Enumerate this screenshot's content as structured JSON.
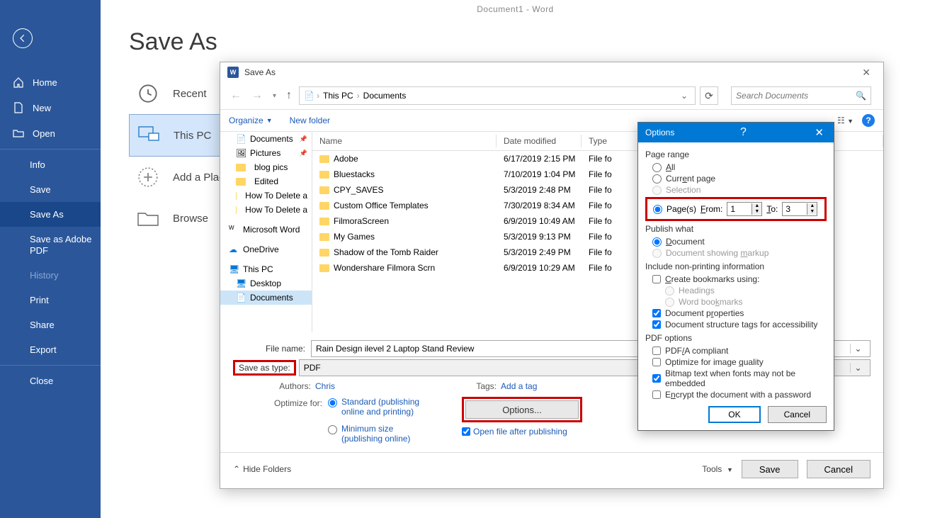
{
  "titlebar": "Document1  -  Word",
  "page_heading": "Save As",
  "sidebar": {
    "home": "Home",
    "new": "New",
    "open": "Open",
    "info": "Info",
    "save": "Save",
    "save_as": "Save As",
    "save_adobe": "Save as Adobe PDF",
    "history": "History",
    "print": "Print",
    "share": "Share",
    "export": "Export",
    "close": "Close"
  },
  "locations": {
    "recent": "Recent",
    "this_pc": "This PC",
    "add_place": "Add a Place",
    "browse": "Browse"
  },
  "dialog": {
    "title": "Save As",
    "breadcrumb": {
      "seg1": "This PC",
      "seg2": "Documents"
    },
    "search_placeholder": "Search Documents",
    "organize": "Organize",
    "new_folder": "New folder",
    "cols": {
      "name": "Name",
      "date": "Date modified",
      "type": "Type"
    },
    "tree": {
      "documents": "Documents",
      "pictures": "Pictures",
      "blog": "blog pics",
      "edited": "Edited",
      "howto1": "How To Delete a",
      "howto2": "How To Delete a",
      "msword": "Microsoft Word",
      "onedrive": "OneDrive",
      "thispc": "This PC",
      "desktop": "Desktop",
      "documents2": "Documents"
    },
    "files": [
      {
        "name": "Adobe",
        "date": "6/17/2019 2:15 PM",
        "type": "File fo"
      },
      {
        "name": "Bluestacks",
        "date": "7/10/2019 1:04 PM",
        "type": "File fo"
      },
      {
        "name": "CPY_SAVES",
        "date": "5/3/2019 2:48 PM",
        "type": "File fo"
      },
      {
        "name": "Custom Office Templates",
        "date": "7/30/2019 8:34 AM",
        "type": "File fo"
      },
      {
        "name": "FilmoraScreen",
        "date": "6/9/2019 10:49 AM",
        "type": "File fo"
      },
      {
        "name": "My Games",
        "date": "5/3/2019 9:13 PM",
        "type": "File fo"
      },
      {
        "name": "Shadow of the Tomb Raider",
        "date": "5/3/2019 2:49 PM",
        "type": "File fo"
      },
      {
        "name": "Wondershare Filmora Scrn",
        "date": "6/9/2019 10:29 AM",
        "type": "File fo"
      }
    ],
    "file_name_label": "File name:",
    "file_name_value": "Rain Design ilevel 2 Laptop Stand Review",
    "save_type_label": "Save as type:",
    "save_type_value": "PDF",
    "authors_label": "Authors:",
    "authors_value": "Chris",
    "tags_label": "Tags:",
    "tags_value": "Add a tag",
    "optimize_label": "Optimize for:",
    "opt_standard": "Standard (publishing online and printing)",
    "opt_minimum": "Minimum size (publishing online)",
    "options_btn": "Options...",
    "open_after": "Open file after publishing",
    "hide_folders": "Hide Folders",
    "tools": "Tools",
    "save_btn": "Save",
    "cancel_btn": "Cancel"
  },
  "options": {
    "title": "Options",
    "page_range": "Page range",
    "all": "All",
    "current": "Current page",
    "selection": "Selection",
    "pages": "Page(s)",
    "from": "From:",
    "from_val": "1",
    "to": "To:",
    "to_val": "3",
    "publish_what": "Publish what",
    "document": "Document",
    "markup": "Document showing markup",
    "include": "Include non-printing information",
    "bookmarks": "Create bookmarks using:",
    "headings": "Headings",
    "word_bm": "Word bookmarks",
    "doc_props": "Document properties",
    "struct_tags": "Document structure tags for accessibility",
    "pdf_options": "PDF options",
    "pdfa": "PDF/A compliant",
    "iq": "Optimize for image quality",
    "bitmap": "Bitmap text when fonts may not be embedded",
    "encrypt": "Encrypt the document with a password",
    "ok": "OK",
    "cancel": "Cancel"
  }
}
